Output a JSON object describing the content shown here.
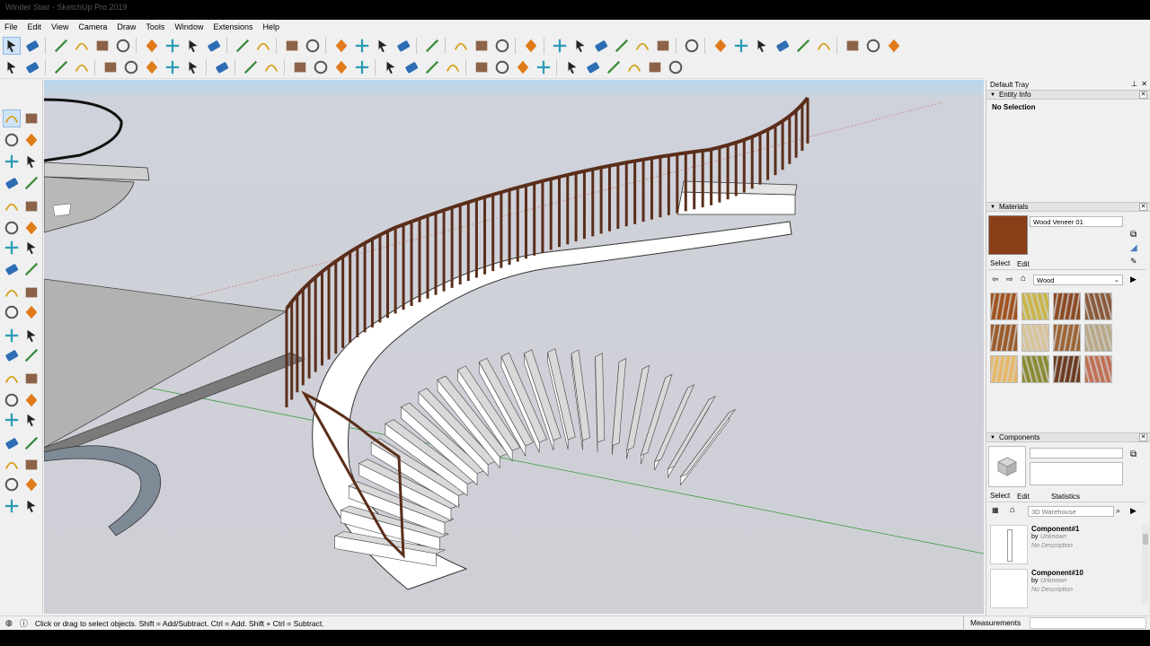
{
  "app": {
    "window_title": "Winder Stair - SketchUp Pro 2019"
  },
  "menu": [
    "File",
    "Edit",
    "View",
    "Camera",
    "Draw",
    "Tools",
    "Window",
    "Extensions",
    "Help"
  ],
  "toolbar_icons": {
    "row1": [
      "select-icon",
      "eraser-icon",
      "line-icon",
      "arc-icon",
      "rectangle-icon",
      "push-pull-icon",
      "follow-me-icon",
      "move-icon",
      "rotate-icon",
      "scale-icon",
      "offset-icon",
      "tape-measure-icon",
      "text-icon",
      "paint-bucket-icon",
      "orbit-icon",
      "pan-icon",
      "zoom-icon",
      "zoom-extents-icon",
      "position-camera-icon",
      "section-plane-icon",
      "layers-icon",
      "styles-icon",
      "add-location-icon",
      "iso-view-icon",
      "top-view-icon",
      "front-view-icon",
      "right-view-icon",
      "back-view-icon",
      "left-view-icon",
      "components-icon",
      "xray-icon",
      "back-edges-icon",
      "wireframe-icon",
      "hidden-line-icon",
      "shaded-icon",
      "axes-icon",
      "section-cut-icon",
      "monochrome-icon",
      "shaded-textures-icon"
    ],
    "row2": [
      "material-palette-icon",
      "styles-settings-icon",
      "move-z-icon",
      "flip-icon",
      "solid-union-icon",
      "solid-subtract-icon",
      "solid-trim-icon",
      "solid-split-icon",
      "align-icon",
      "walk-icon",
      "look-around-icon",
      "sandbox-icon",
      "smoove-icon",
      "drape-icon",
      "add-detail-icon",
      "flip-edge-icon",
      "extension-warehouse-icon",
      "3d-warehouse-icon",
      "share-model-icon",
      "styles-builder-icon",
      "send-to-layout-icon",
      "export-icon",
      "info-icon",
      "photo-match-icon",
      "texture-icon",
      "stamp-icon",
      "terrain-icon",
      "outer-shell-icon",
      "intersect-icon",
      "union-icon"
    ]
  },
  "left_tools": [
    "select-icon",
    "component-icon",
    "paint-bucket-icon",
    "eraser-icon",
    "line-icon",
    "freehand-icon",
    "rectangle-icon",
    "rotated-rectangle-icon",
    "circle-icon",
    "polygon-icon",
    "arc-icon",
    "pie-icon",
    "three-point-arc-icon",
    "two-point-arc-icon",
    "move-icon",
    "push-pull-icon",
    "rotate-icon",
    "follow-me-icon",
    "scale-icon",
    "offset-icon",
    "tape-measure-icon",
    "dimension-icon",
    "protractor-icon",
    "text-icon",
    "axes-icon",
    "3d-text-icon",
    "orbit-icon",
    "pan-icon",
    "zoom-icon",
    "zoom-window-icon",
    "zoom-extents-icon",
    "previous-view-icon",
    "position-camera-icon",
    "look-around-icon",
    "walk-icon",
    "section-plane-icon",
    "display-section-icon",
    "section-fill-icon"
  ],
  "tray": {
    "title": "Default Tray",
    "entity_info": {
      "heading": "Entity Info",
      "selection": "No Selection"
    },
    "materials": {
      "heading": "Materials",
      "current_material": "Wood Veneer 01",
      "tabs": [
        "Select",
        "Edit"
      ],
      "library": "Wood",
      "swatch_colors": [
        "#a0521e",
        "#c9b54a",
        "#8b4a24",
        "#8a5a3a",
        "#9a5a2a",
        "#d8c49a",
        "#9c6436",
        "#b8a888",
        "#e6b868",
        "#8a8a32",
        "#6a3a20",
        "#c07054"
      ]
    },
    "components": {
      "heading": "Components",
      "tabs": [
        "Select",
        "Edit",
        "Statistics"
      ],
      "search_placeholder": "3D Warehouse",
      "items": [
        {
          "name": "Component#1",
          "author_label": "by",
          "author": "Unknown",
          "description": "No Description"
        },
        {
          "name": "Component#10",
          "author_label": "by",
          "author": "Unknown",
          "description": "No Description"
        }
      ]
    }
  },
  "status": {
    "hint": "Click or drag to select objects. Shift = Add/Subtract. Ctrl = Add. Shift + Ctrl = Subtract.",
    "measurements_label": "Measurements"
  },
  "colors": {
    "sky": "#cfcfd6",
    "wood": "#5a2e1a",
    "floor": "#b0b0b0",
    "step_top": "#e8e8e8",
    "step_face": "#ffffff",
    "selection_blue": "#cfe3f7"
  }
}
